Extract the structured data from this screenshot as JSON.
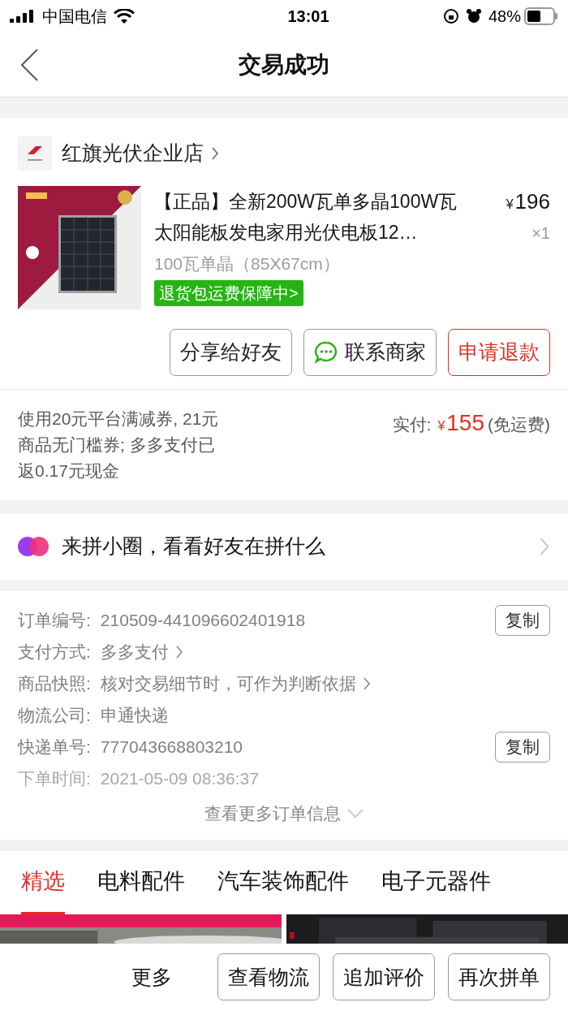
{
  "status_bar": {
    "carrier": "中国电信",
    "time": "13:01",
    "battery": "48%"
  },
  "nav": {
    "title": "交易成功"
  },
  "store": {
    "name": "红旗光伏企业店"
  },
  "product": {
    "title": "【正品】全新200W瓦单多晶100W瓦太阳能板发电家用光伏电板12…",
    "price_symbol": "¥",
    "price": "196",
    "quantity": "×1",
    "spec": "100瓦单晶（85X67cm）",
    "guarantee": "退货包运费保障中>"
  },
  "actions": [
    {
      "label": "分享给好友",
      "kind": "plain"
    },
    {
      "label": "联系商家",
      "kind": "chat"
    },
    {
      "label": "申请退款",
      "kind": "danger"
    }
  ],
  "payment": {
    "note": "使用20元平台满减券, 21元商品无门槛券; 多多支付已返0.17元现金",
    "paid_label": "实付:",
    "currency": "¥",
    "amount": "155",
    "shipping": "(免运费)"
  },
  "circle": {
    "text": "来拼小圈，看看好友在拼什么"
  },
  "order_info": [
    {
      "label": "订单编号:",
      "value": "210509-441096602401918",
      "copy": "复制",
      "arrow": false,
      "faded": false
    },
    {
      "label": "支付方式:",
      "value": "多多支付",
      "arrow": true,
      "faded": false
    },
    {
      "label": "商品快照:",
      "value": "核对交易细节时，可作为判断依据",
      "arrow": true,
      "faded": false
    },
    {
      "label": "物流公司:",
      "value": "申通快递",
      "arrow": false,
      "faded": false
    },
    {
      "label": "快递单号:",
      "value": "777043668803210",
      "copy": "复制",
      "arrow": false,
      "faded": false
    },
    {
      "label": "下单时间:",
      "value": "2021-05-09 08:36:37",
      "arrow": false,
      "faded": true
    }
  ],
  "more_info": "查看更多订单信息",
  "tabs": [
    {
      "label": "精选",
      "selected": true
    },
    {
      "label": "电料配件",
      "selected": false
    },
    {
      "label": "汽车装饰配件",
      "selected": false
    },
    {
      "label": "电子元器件",
      "selected": false
    }
  ],
  "bottom_bar": {
    "more": "更多",
    "buttons": [
      "查看物流",
      "追加评价",
      "再次拼单"
    ]
  }
}
